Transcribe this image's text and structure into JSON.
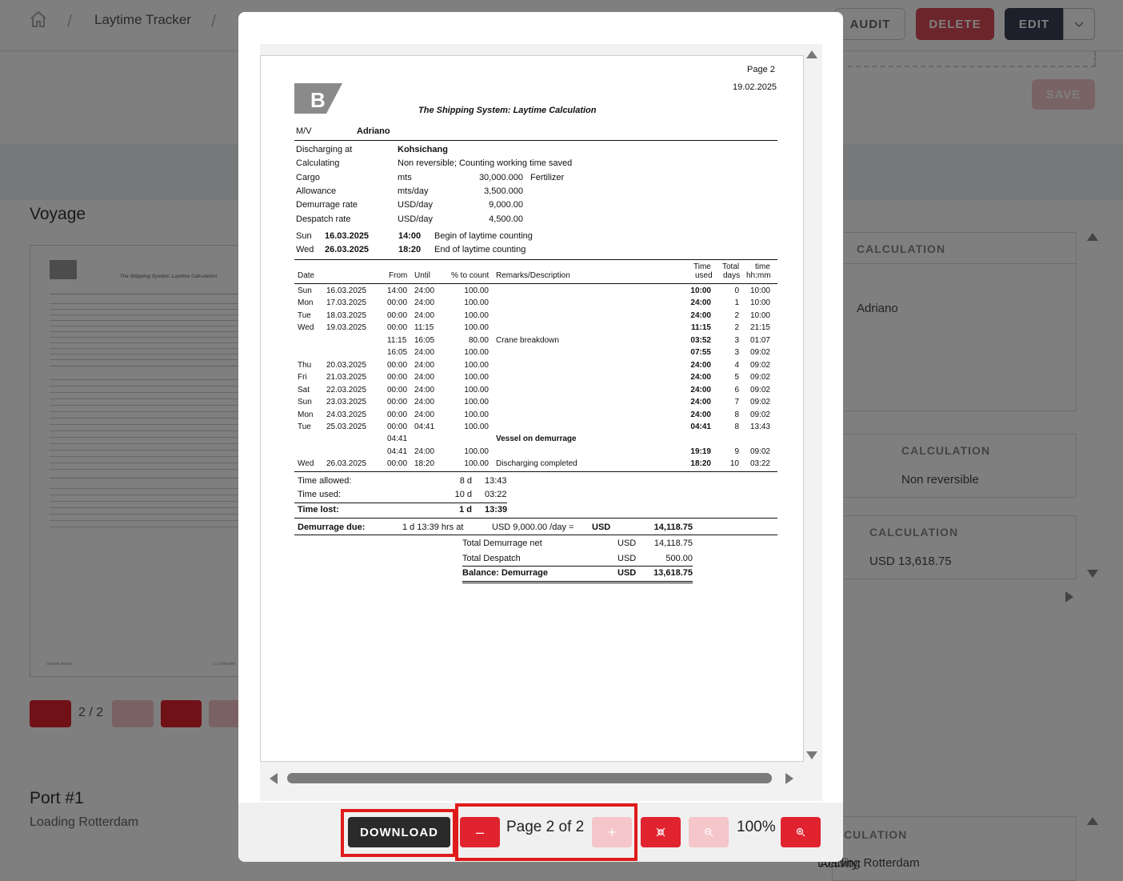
{
  "app": {
    "breadcrumb": {
      "current": "Laytime Tracker"
    },
    "actions": {
      "audit": "AUDIT",
      "delete": "DELETE",
      "edit": "EDIT",
      "save": "SAVE"
    },
    "voyage_heading": "Voyage",
    "thumb_pager": "2 / 2",
    "port": {
      "heading": "Port #1",
      "subtitle": "Loading Rotterdam"
    },
    "calc_cards": [
      {
        "header": "CALCULATION",
        "value": "Adriano"
      },
      {
        "header": "CALCULATION",
        "value": "Non reversible"
      },
      {
        "header": "CALCULATION",
        "value": "USD 13,618.75"
      },
      {
        "header": "CULATION",
        "label": "Activity:",
        "value": "Loading Rotterdam"
      }
    ]
  },
  "document": {
    "page_label": "Page 2",
    "date": "19.02.2025",
    "title": "The Shipping System: Laytime Calculation",
    "vessel_label": "M/V",
    "vessel": "Adriano",
    "info": [
      {
        "label": "Discharging at",
        "value": "Kohsichang",
        "bold": true
      },
      {
        "label": "Calculating",
        "value": "Non reversible; Counting working time saved"
      },
      {
        "label": "Cargo",
        "unit": "mts",
        "amount": "30,000.000",
        "extra": "Fertilizer"
      },
      {
        "label": "Allowance",
        "unit": "mts/day",
        "amount": "3,500.000"
      },
      {
        "label": "Demurrage rate",
        "unit": "USD/day",
        "amount": "9,000.00"
      },
      {
        "label": "Despatch rate",
        "unit": "USD/day",
        "amount": "4,500.00"
      }
    ],
    "laytime": [
      {
        "day": "Sun",
        "date": "16.03.2025",
        "time": "14:00",
        "desc": "Begin of laytime counting"
      },
      {
        "day": "Wed",
        "date": "26.03.2025",
        "time": "18:20",
        "desc": "End of laytime counting"
      }
    ],
    "columns": {
      "date": "Date",
      "from": "From",
      "until": "Until",
      "pct": "% to count",
      "remarks": "Remarks/Description",
      "time_used_1": "Time",
      "time_used_2": "used",
      "total_1": "Total",
      "total_2": "days",
      "hhmm_1": "time",
      "hhmm_2": "hh:mm"
    },
    "rows": [
      {
        "day": "Sun",
        "date": "16.03.2025",
        "from": "14:00",
        "until": "24:00",
        "pct": "100.00",
        "remarks": "",
        "used": "10:00",
        "days": "0",
        "hhmm": "10:00"
      },
      {
        "day": "Mon",
        "date": "17.03.2025",
        "from": "00:00",
        "until": "24:00",
        "pct": "100.00",
        "remarks": "",
        "used": "24:00",
        "days": "1",
        "hhmm": "10:00"
      },
      {
        "day": "Tue",
        "date": "18.03.2025",
        "from": "00:00",
        "until": "24:00",
        "pct": "100.00",
        "remarks": "",
        "used": "24:00",
        "days": "2",
        "hhmm": "10:00"
      },
      {
        "day": "Wed",
        "date": "19.03.2025",
        "from": "00:00",
        "until": "11:15",
        "pct": "100.00",
        "remarks": "",
        "used": "11:15",
        "days": "2",
        "hhmm": "21:15"
      },
      {
        "day": "",
        "date": "",
        "from": "11:15",
        "until": "16:05",
        "pct": "80.00",
        "remarks": "Crane breakdown",
        "used": "03:52",
        "days": "3",
        "hhmm": "01:07"
      },
      {
        "day": "",
        "date": "",
        "from": "16:05",
        "until": "24:00",
        "pct": "100.00",
        "remarks": "",
        "used": "07:55",
        "days": "3",
        "hhmm": "09:02"
      },
      {
        "day": "Thu",
        "date": "20.03.2025",
        "from": "00:00",
        "until": "24:00",
        "pct": "100.00",
        "remarks": "",
        "used": "24:00",
        "days": "4",
        "hhmm": "09:02"
      },
      {
        "day": "Fri",
        "date": "21.03.2025",
        "from": "00:00",
        "until": "24:00",
        "pct": "100.00",
        "remarks": "",
        "used": "24:00",
        "days": "5",
        "hhmm": "09:02"
      },
      {
        "day": "Sat",
        "date": "22.03.2025",
        "from": "00:00",
        "until": "24:00",
        "pct": "100.00",
        "remarks": "",
        "used": "24:00",
        "days": "6",
        "hhmm": "09:02"
      },
      {
        "day": "Sun",
        "date": "23.03.2025",
        "from": "00:00",
        "until": "24:00",
        "pct": "100.00",
        "remarks": "",
        "used": "24:00",
        "days": "7",
        "hhmm": "09:02"
      },
      {
        "day": "Mon",
        "date": "24.03.2025",
        "from": "00:00",
        "until": "24:00",
        "pct": "100.00",
        "remarks": "",
        "used": "24:00",
        "days": "8",
        "hhmm": "09:02"
      },
      {
        "day": "Tue",
        "date": "25.03.2025",
        "from": "00:00",
        "until": "04:41",
        "pct": "100.00",
        "remarks": "",
        "used": "04:41",
        "days": "8",
        "hhmm": "13:43"
      },
      {
        "day": "",
        "date": "",
        "from": "04:41",
        "until": "",
        "pct": "",
        "remarks": "Vessel on demurrage",
        "remarks_bold": true,
        "used": "",
        "days": "",
        "hhmm": ""
      },
      {
        "day": "",
        "date": "",
        "from": "04:41",
        "until": "24:00",
        "pct": "100.00",
        "remarks": "",
        "used": "19:19",
        "days": "9",
        "hhmm": "09:02"
      },
      {
        "day": "Wed",
        "date": "26.03.2025",
        "from": "00:00",
        "until": "18:20",
        "pct": "100.00",
        "remarks": "Discharging completed",
        "used": "18:20",
        "days": "10",
        "hhmm": "03:22"
      }
    ],
    "summary": {
      "allowed_label": "Time allowed:",
      "allowed_d": "8 d",
      "allowed_t": "13:43",
      "used_label": "Time used:",
      "used_d": "10 d",
      "used_t": "03:22",
      "lost_label": "Time lost:",
      "lost_d": "1 d",
      "lost_t": "13:39"
    },
    "demurrage": {
      "label": "Demurrage due:",
      "calc": "1 d 13:39 hrs at",
      "rate": "USD 9,000.00 /day =",
      "currency": "USD",
      "amount": "14,118.75"
    },
    "totals": [
      {
        "label": "Total Demurrage net",
        "currency": "USD",
        "amount": "14,118.75"
      },
      {
        "label": "Total Despatch",
        "currency": "USD",
        "amount": "500.00"
      },
      {
        "label": "Balance: Demurrage",
        "currency": "USD",
        "amount": "13,618.75",
        "bold": true
      }
    ]
  },
  "thumb_text": {
    "title": "The Shipping System: Laytime Calculation",
    "footer_left": "Sample Adelar",
    "footer_right": "(c) Softwater"
  },
  "toolbar": {
    "download": "DOWNLOAD",
    "page_indicator": "Page 2 of 2",
    "zoom": "100%"
  },
  "colors": {
    "accent": "#e0232f",
    "accent_disabled": "#f4c5c9",
    "dark_button": "#2a2a2a",
    "highlight": "#e01b1b"
  }
}
